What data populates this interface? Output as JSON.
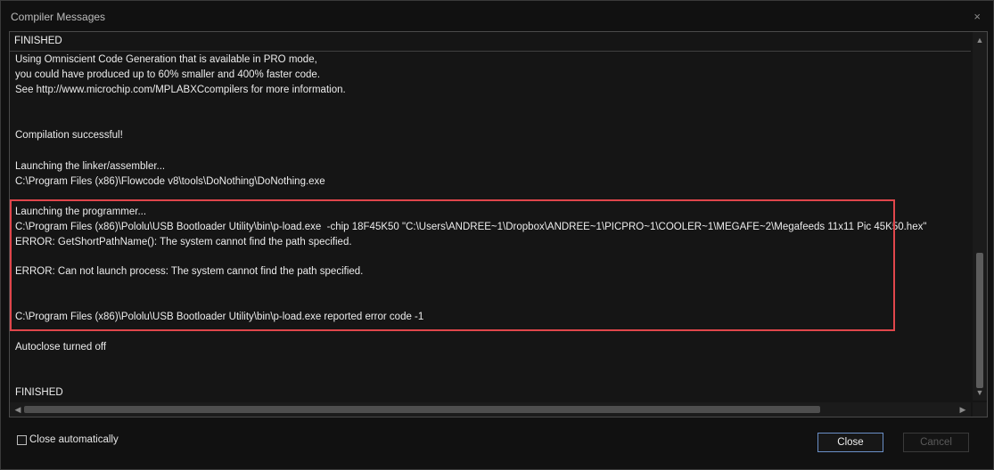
{
  "window": {
    "title": "Compiler Messages",
    "close_glyph": "×"
  },
  "log": {
    "header": "FINISHED",
    "lines": [
      "Using Omniscient Code Generation that is available in PRO mode,",
      "you could have produced up to 60% smaller and 400% faster code.",
      "See http://www.microchip.com/MPLABXCcompilers for more information.",
      "Compilation successful!",
      "Launching the linker/assembler...",
      "C:\\Program Files (x86)\\Flowcode v8\\tools\\DoNothing\\DoNothing.exe",
      "Launching the programmer...",
      "C:\\Program Files (x86)\\Pololu\\USB Bootloader Utility\\bin\\p-load.exe  -chip 18F45K50 \"C:\\Users\\ANDREE~1\\Dropbox\\ANDREE~1\\PICPRO~1\\COOLER~1\\MEGAFE~2\\Megafeeds 11x11 Pic 45K50.hex\"",
      "ERROR: GetShortPathName(): The system cannot find the path specified.",
      "ERROR: Can not launch process: The system cannot find the path specified.",
      "C:\\Program Files (x86)\\Pololu\\USB Bootloader Utility\\bin\\p-load.exe reported error code -1",
      "Autoclose turned off",
      "FINISHED"
    ]
  },
  "footer": {
    "checkbox_label": "Close automatically",
    "checkbox_checked": false,
    "close_label": "Close",
    "cancel_label": "Cancel"
  },
  "colors": {
    "highlight_border": "#e0464b",
    "primary_button_border": "#6a8fc7"
  },
  "icons": {
    "scroll_up": "scroll-up-arrow-icon",
    "scroll_down": "scroll-down-arrow-icon",
    "scroll_left": "scroll-left-arrow-icon",
    "scroll_right": "scroll-right-arrow-icon"
  }
}
